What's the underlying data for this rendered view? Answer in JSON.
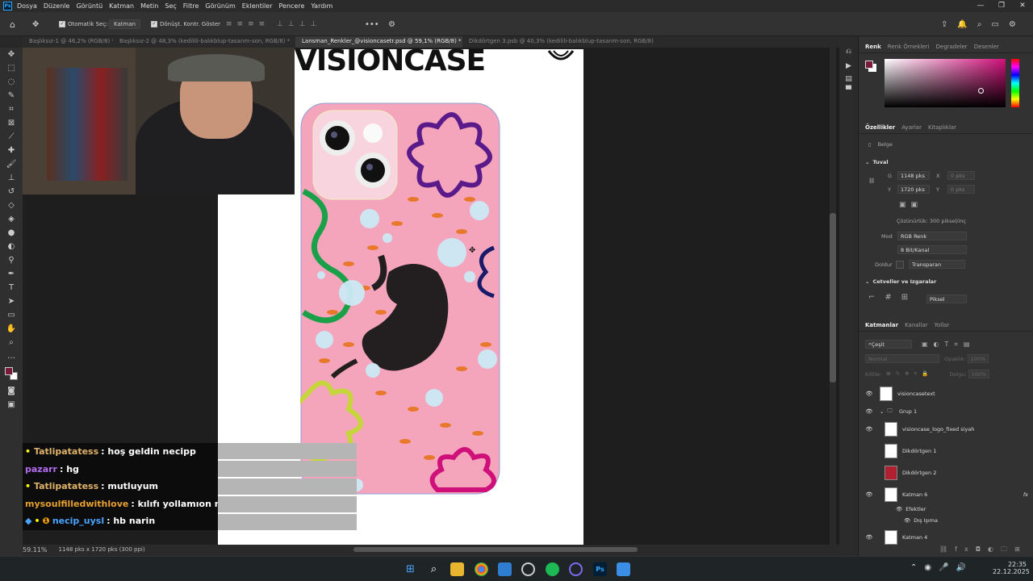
{
  "app": {
    "logo": "Ps",
    "menu": [
      "Dosya",
      "Düzenle",
      "Görüntü",
      "Katman",
      "Metin",
      "Seç",
      "Filtre",
      "Görünüm",
      "Eklentiler",
      "Pencere",
      "Yardım"
    ]
  },
  "options": {
    "autoselect": "Otomatik Seç:",
    "autoselect_target": "Katman",
    "transform": "Dönüşt. Kontr. Göster"
  },
  "tabs": [
    {
      "label": "Başlıksız-1 @ 46,2% (RGB/8) *"
    },
    {
      "label": "Başlıksız-2 @ 48,3% (kedilili-balıkblup-tasarım-son, RGB/8) *"
    },
    {
      "label": "Lansman_Renkler_@visioncasetr.psd @ 59,1% (RGB/8) *"
    },
    {
      "label": "Dikdörtgen 3.psb @ 40,3% (kedilili-balıkblup-tasarım-son, RGB/8)"
    }
  ],
  "canvas": {
    "brand_text": "VISIONCASE"
  },
  "chat": [
    {
      "user": "Tatlipatatess",
      "msg": ": hoş geldin necipp",
      "color": "#e0b36a"
    },
    {
      "user": "pazarr",
      "msg": ": hg",
      "color": "#b36cf0"
    },
    {
      "user": "Tatlipatatess",
      "msg": ": mutluyum",
      "color": "#e0b36a"
    },
    {
      "user": "mysoulfilledwithlove",
      "msg": ": kılıfı yollamıon mu",
      "color": "#e8a030"
    },
    {
      "user": "necip_uysl",
      "msg": ": hb narin",
      "color": "#4aa3ff"
    }
  ],
  "status": {
    "zoom": "59.11%",
    "doc": "1148 pks x 1720 pks (300 ppi)"
  },
  "colorpanel": {
    "tabs": [
      "Renk",
      "Renk Örnekleri",
      "Degradeler",
      "Desenler"
    ],
    "fg": "#7a1a3a",
    "bg": "#ffffff"
  },
  "props": {
    "tabs": [
      "Özellikler",
      "Ayarlar",
      "Kitaplıklar"
    ],
    "doc_label": "Belge",
    "canvas_title": "Tuval",
    "w_label": "G",
    "w_value": "1148 pks",
    "x_label": "X",
    "x_value": "0 pks",
    "h_label": "Y",
    "h_value": "1720 pks",
    "y_label": "Y",
    "y_value": "0 pks",
    "resolution": "Çözünürlük: 300 piksel/inç",
    "mode_label": "Mod",
    "mode_value": "RGB Renk",
    "depth_value": "8 Bit/Kanal",
    "fill_label": "Doldur",
    "fill_value": "Transparan",
    "rulers_title": "Cetveller ve Izgaralar",
    "units": "Piksel"
  },
  "layerspanel": {
    "tabs": [
      "Katmanlar",
      "Kanallar",
      "Yollar"
    ],
    "filter": "Çeşit",
    "blend": "Normal",
    "opacity_label": "Opaklık:",
    "opacity": "100%",
    "lock_label": "Kilitle:",
    "fill_label": "Dolgu:",
    "fill": "100%",
    "layers": [
      {
        "name": "visioncasetext",
        "visible": true,
        "indent": 0
      },
      {
        "name": "Grup 1",
        "visible": true,
        "indent": 0
      },
      {
        "name": "visioncase_logo_fixed siyah",
        "visible": true,
        "indent": 1
      },
      {
        "name": "Dikdörtgen 1",
        "visible": false,
        "indent": 1
      },
      {
        "name": "Dikdörtgen 2",
        "visible": false,
        "indent": 1
      },
      {
        "name": "Katman 6",
        "visible": true,
        "indent": 1
      },
      {
        "name": "Efektler",
        "visible": true,
        "indent": 2
      },
      {
        "name": "Dış Işıma",
        "visible": true,
        "indent": 3
      },
      {
        "name": "Katman 4",
        "visible": true,
        "indent": 1
      }
    ]
  },
  "taskbar": {
    "time": "22:35",
    "date": "22.12.2025"
  }
}
